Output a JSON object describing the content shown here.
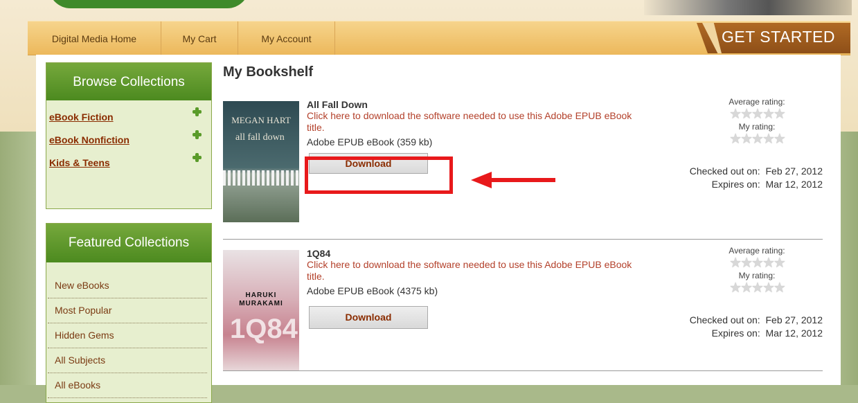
{
  "nav": {
    "home": "Digital Media Home",
    "cart": "My Cart",
    "account": "My Account",
    "get_started": "GET STARTED"
  },
  "browse": {
    "title": "Browse Collections",
    "items": [
      {
        "label": "eBook Fiction"
      },
      {
        "label": "eBook Nonfiction"
      },
      {
        "label": "Kids & Teens"
      }
    ]
  },
  "featured": {
    "title": "Featured Collections",
    "items": [
      {
        "label": "New eBooks"
      },
      {
        "label": "Most Popular"
      },
      {
        "label": "Hidden Gems"
      },
      {
        "label": "All Subjects"
      },
      {
        "label": "All eBooks"
      }
    ]
  },
  "bookshelf": {
    "title": "My Bookshelf",
    "books": [
      {
        "title": "All Fall Down",
        "download_info": "Click here to download the software needed to use this Adobe EPUB eBook title.",
        "format": "Adobe EPUB eBook (359 kb)",
        "download_label": "Download",
        "avg_rating_label": "Average rating:",
        "my_rating_label": "My rating:",
        "checked_out_label": "Checked out on:",
        "checked_out": "Feb 27, 2012",
        "expires_label": "Expires on:",
        "expires": "Mar 12, 2012",
        "cover_author": "MEGAN HART",
        "cover_title": "all fall down"
      },
      {
        "title": "1Q84",
        "download_info": "Click here to download the software needed to use this Adobe EPUB eBook title.",
        "format": "Adobe EPUB eBook (4375 kb)",
        "download_label": "Download",
        "avg_rating_label": "Average rating:",
        "my_rating_label": "My rating:",
        "checked_out_label": "Checked out on:",
        "checked_out": "Feb 27, 2012",
        "expires_label": "Expires on:",
        "expires": "Mar 12, 2012",
        "cover_author": "HARUKI MURAKAMI",
        "cover_title": "1Q84"
      }
    ]
  },
  "colors": {
    "annotation": "#e8191b",
    "link": "#8a2c00",
    "accent_green": "#4c8a1f"
  }
}
